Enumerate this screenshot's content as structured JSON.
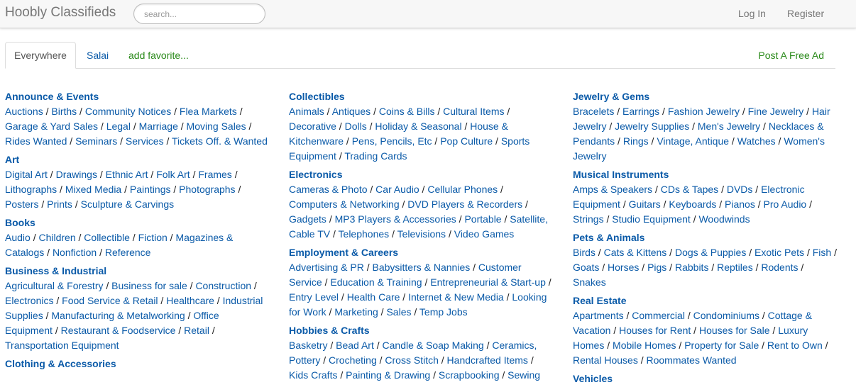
{
  "header": {
    "brand": "Hoobly Classifieds",
    "search_placeholder": "search...",
    "login": "Log In",
    "register": "Register"
  },
  "tabs": {
    "everywhere": "Everywhere",
    "location": "Salai",
    "add_favorite": "add favorite...",
    "post_ad": "Post A Free Ad"
  },
  "columns": [
    [
      {
        "title": "Announce & Events",
        "links": [
          "Auctions",
          "Births",
          "Community Notices",
          "Flea Markets",
          "Garage & Yard Sales",
          "Legal",
          "Marriage",
          "Moving Sales",
          "Rides Wanted",
          "Seminars",
          "Services",
          "Tickets Off. & Wanted"
        ]
      },
      {
        "title": "Art",
        "links": [
          "Digital Art",
          "Drawings",
          "Ethnic Art",
          "Folk Art",
          "Frames",
          "Lithographs",
          "Mixed Media",
          "Paintings",
          "Photographs",
          "Posters",
          "Prints",
          "Sculpture & Carvings"
        ]
      },
      {
        "title": "Books",
        "links": [
          "Audio",
          "Children",
          "Collectible",
          "Fiction",
          "Magazines & Catalogs",
          "Nonfiction",
          "Reference"
        ]
      },
      {
        "title": "Business & Industrial",
        "links": [
          "Agricultural & Forestry",
          "Business for sale",
          "Construction",
          "Electronics",
          "Food Service & Retail",
          "Healthcare",
          "Industrial Supplies",
          "Manufacturing & Metalworking",
          "Office Equipment",
          "Restaurant & Foodservice",
          "Retail",
          "Transportation Equipment"
        ]
      },
      {
        "title": "Clothing & Accessories",
        "links": []
      }
    ],
    [
      {
        "title": "Collectibles",
        "links": [
          "Animals",
          "Antiques",
          "Coins & Bills",
          "Cultural Items",
          "Decorative",
          "Dolls",
          "Holiday & Seasonal",
          "House & Kitchenware",
          "Pens, Pencils, Etc",
          "Pop Culture",
          "Sports Equipment",
          "Trading Cards"
        ]
      },
      {
        "title": "Electronics",
        "links": [
          "Cameras & Photo",
          "Car Audio",
          "Cellular Phones",
          "Computers & Networking",
          "DVD Players & Recorders",
          "Gadgets",
          "MP3 Players & Accessories",
          "Portable",
          "Satellite, Cable TV",
          "Telephones",
          "Televisions",
          "Video Games"
        ]
      },
      {
        "title": "Employment & Careers",
        "links": [
          "Advertising & PR",
          "Babysitters & Nannies",
          "Customer Service",
          "Education & Training",
          "Entrepreneurial & Start-up",
          "Entry Level",
          "Health Care",
          "Internet & New Media",
          "Looking for Work",
          "Marketing",
          "Sales",
          "Temp Jobs"
        ]
      },
      {
        "title": "Hobbies & Crafts",
        "links": [
          "Basketry",
          "Bead Art",
          "Candle & Soap Making",
          "Ceramics, Pottery",
          "Crocheting",
          "Cross Stitch",
          "Handcrafted Items",
          "Kids Crafts",
          "Painting & Drawing",
          "Scrapbooking",
          "Sewing"
        ]
      }
    ],
    [
      {
        "title": "Jewelry & Gems",
        "links": [
          "Bracelets",
          "Earrings",
          "Fashion Jewelry",
          "Fine Jewelry",
          "Hair Jewelry",
          "Jewelry Supplies",
          "Men's Jewelry",
          "Necklaces & Pendants",
          "Rings",
          "Vintage, Antique",
          "Watches",
          "Women's Jewelry"
        ]
      },
      {
        "title": "Musical Instruments",
        "links": [
          "Amps & Speakers",
          "CDs & Tapes",
          "DVDs",
          "Electronic Equipment",
          "Guitars",
          "Keyboards",
          "Pianos",
          "Pro Audio",
          "Strings",
          "Studio Equipment",
          "Woodwinds"
        ]
      },
      {
        "title": "Pets & Animals",
        "links": [
          "Birds",
          "Cats & Kittens",
          "Dogs & Puppies",
          "Exotic Pets",
          "Fish",
          "Goats",
          "Horses",
          "Pigs",
          "Rabbits",
          "Reptiles",
          "Rodents",
          "Snakes"
        ]
      },
      {
        "title": "Real Estate",
        "links": [
          "Apartments",
          "Commercial",
          "Condominiums",
          "Cottage & Vacation",
          "Houses for Rent",
          "Houses for Sale",
          "Luxury Homes",
          "Mobile Homes",
          "Property for Sale",
          "Rent to Own",
          "Rental Houses",
          "Roommates Wanted"
        ]
      },
      {
        "title": "Vehicles",
        "links": []
      }
    ]
  ]
}
